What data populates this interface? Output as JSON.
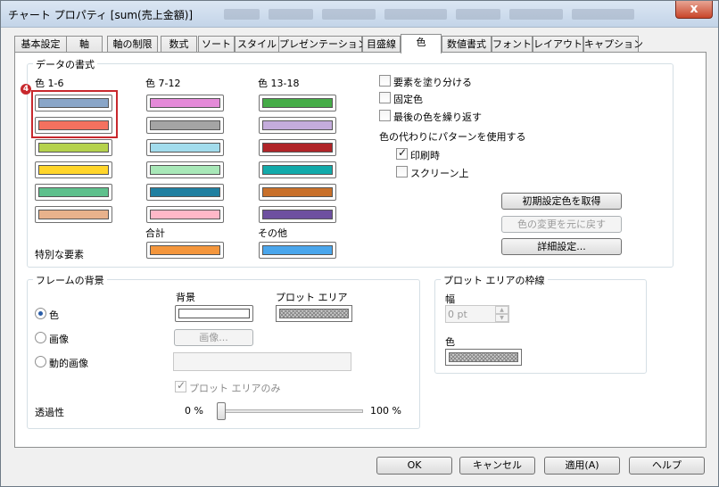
{
  "window": {
    "title": "チャート プロパティ [sum(売上金額)]",
    "close_label": "x"
  },
  "tabs": [
    {
      "label": "基本設定"
    },
    {
      "label": "軸"
    },
    {
      "label": "軸の制限"
    },
    {
      "label": "数式"
    },
    {
      "label": "ソート"
    },
    {
      "label": "スタイル"
    },
    {
      "label": "プレゼンテーション"
    },
    {
      "label": "目盛線"
    },
    {
      "label": "色"
    },
    {
      "label": "数値書式"
    },
    {
      "label": "フォント"
    },
    {
      "label": "レイアウト"
    },
    {
      "label": "キャプション"
    }
  ],
  "active_tab": "色",
  "data_format": {
    "legend": "データの書式",
    "col1_label": "色 1-6",
    "col2_label": "色 7-12",
    "col3_label": "色 13-18",
    "colors_1_6": [
      "#8aa6c8",
      "#f4715f",
      "#b5d24c",
      "#ffd52a",
      "#5ec08c",
      "#e8b28c"
    ],
    "colors_7_12": [
      "#e48ad8",
      "#a4a4a4",
      "#a2dcec",
      "#a8e8b8",
      "#1f7fa0",
      "#ffb8c8"
    ],
    "colors_13_18": [
      "#46ac48",
      "#c4acdc",
      "#b02428",
      "#12aaaa",
      "#c8702a",
      "#6e50a0"
    ],
    "total_label": "合計",
    "other_label": "その他",
    "special_label": "特別な要素",
    "total_color": "#f4963c",
    "other_color": "#4aa6ec",
    "annotation": "4",
    "annotation_color": "#c8282d",
    "options": {
      "fill_by_element": "要素を塗り分ける",
      "fixed_color": "固定色",
      "repeat_last_color": "最後の色を繰り返す",
      "use_pattern": "色の代わりにパターンを使用する",
      "on_print": "印刷時",
      "on_screen": "スクリーン上"
    },
    "option_state": {
      "fill_by_element": false,
      "fixed_color": false,
      "repeat_last_color": false,
      "on_print": true,
      "on_screen": false
    },
    "buttons": {
      "get_defaults": "初期設定色を取得",
      "undo_changes": "色の変更を元に戻す",
      "advanced": "詳細設定..."
    }
  },
  "frame_bg": {
    "legend": "フレームの背景",
    "bg_label": "背景",
    "plot_area_label": "プロット エリア",
    "radio_color": "色",
    "radio_image": "画像",
    "radio_dynamic": "動的画像",
    "image_button": "画像...",
    "plot_only": "プロット エリアのみ",
    "transparency_label": "透過性",
    "transparency_min": "0 %",
    "transparency_max": "100 %",
    "transparency_value": 0,
    "selected_radio": "色",
    "bg_color": "#ffffff"
  },
  "plot_border": {
    "legend": "プロット エリアの枠線",
    "width_label": "幅",
    "width_value": "0 pt",
    "color_label": "色"
  },
  "footer": {
    "ok": "OK",
    "cancel": "キャンセル",
    "apply": "適用(A)",
    "help": "ヘルプ"
  }
}
